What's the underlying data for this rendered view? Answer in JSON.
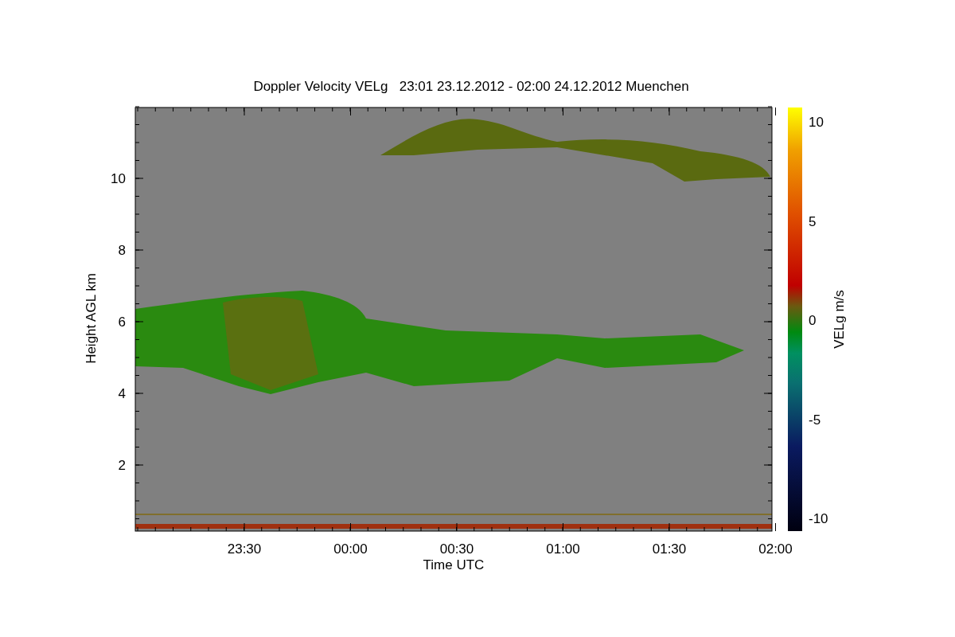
{
  "title": "Doppler Velocity VELg   23:01 23.12.2012 - 02:00 24.12.2012 Muenchen",
  "plot": {
    "ylabel": "Height AGL km",
    "xlabel": "Time UTC",
    "yticks": [
      "10",
      "8",
      "6",
      "4",
      "2"
    ],
    "xticks": [
      "23:30",
      "00:00",
      "00:30",
      "01:00",
      "01:30",
      "02:00"
    ]
  },
  "colorbar": {
    "label": "VELg m/s",
    "ticks": [
      "10",
      "5",
      "0",
      "-5",
      "-10"
    ]
  }
}
